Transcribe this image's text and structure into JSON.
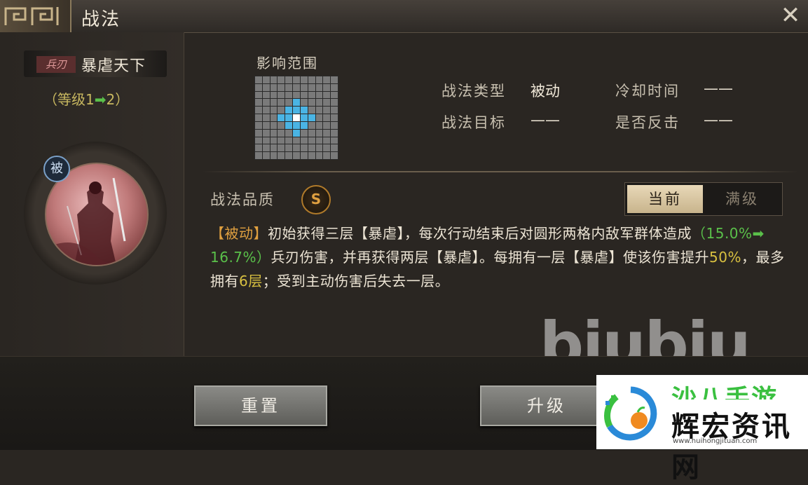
{
  "window": {
    "title": "战法",
    "close_icon": "close-icon"
  },
  "skill": {
    "type_tag": "兵刃",
    "name": "暴虐天下",
    "level_text_prefix": "（等级1",
    "level_arrow": "➡",
    "level_text_suffix": "2）",
    "passive_badge": "被"
  },
  "range": {
    "label": "影响范围",
    "grid_size": 11,
    "hit_cells": [
      [
        3,
        5
      ],
      [
        4,
        4
      ],
      [
        4,
        5
      ],
      [
        4,
        6
      ],
      [
        5,
        3
      ],
      [
        5,
        4
      ],
      [
        5,
        6
      ],
      [
        5,
        7
      ],
      [
        6,
        4
      ],
      [
        6,
        5
      ],
      [
        6,
        6
      ],
      [
        7,
        5
      ]
    ],
    "self_cell": [
      5,
      5
    ]
  },
  "info": {
    "type_label": "战法类型",
    "type_value": "被动",
    "cooldown_label": "冷却时间",
    "cooldown_value": "——",
    "target_label": "战法目标",
    "target_value": "——",
    "counter_label": "是否反击",
    "counter_value": "——"
  },
  "quality": {
    "label": "战法品质",
    "value": "S"
  },
  "tabs": {
    "current": "当前",
    "max": "满级"
  },
  "description": {
    "part1": "【被动】",
    "part2": "初始获得三层【暴虐】，每次行动结束后对圆形两格内敌军群体造成",
    "pct_from": "（15.0%",
    "pct_arrow": "➡",
    "pct_to": " 16.7%）",
    "part3": "兵刃伤害，并再获得两层【暴虐】。每拥有一层【暴虐】使该伤害提升",
    "pct_bonus": "50%",
    "part4": "，最多拥有",
    "max_layers": "6层",
    "part5": "；受到主动伤害后失去一层。"
  },
  "buttons": {
    "reset": "重置",
    "upgrade": "升级"
  },
  "watermark": "biubiu",
  "logo": {
    "top_text": "沙八手游",
    "main_text": "辉宏资讯网",
    "url": "www.huihongjituan.com"
  },
  "colors": {
    "accent_gold": "#e0a040",
    "accent_green": "#5ac04a",
    "range_hit": "#4ab4e4"
  }
}
